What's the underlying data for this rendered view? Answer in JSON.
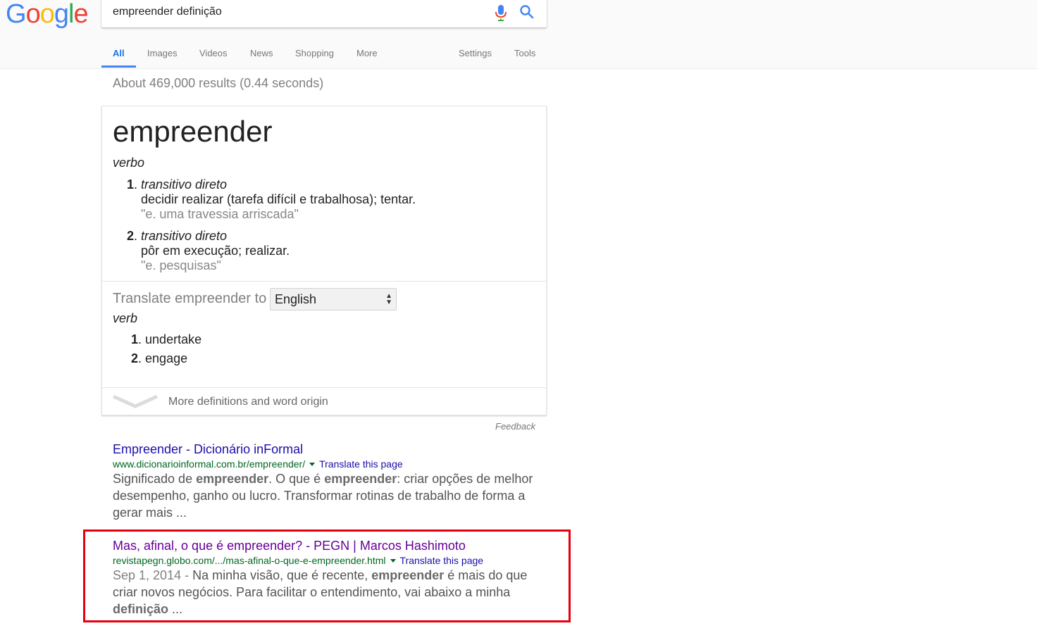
{
  "logo": {
    "letters": [
      "G",
      "o",
      "o",
      "g",
      "l",
      "e"
    ],
    "colors": [
      "#4285f4",
      "#ea4335",
      "#fbbc05",
      "#4285f4",
      "#34a853",
      "#ea4335"
    ]
  },
  "search": {
    "query": "empreender definição"
  },
  "tabs": [
    {
      "label": "All",
      "active": true
    },
    {
      "label": "Images"
    },
    {
      "label": "Videos"
    },
    {
      "label": "News"
    },
    {
      "label": "Shopping"
    },
    {
      "label": "More"
    },
    {
      "label": "Settings"
    },
    {
      "label": "Tools"
    }
  ],
  "stats": "About 469,000 results (0.44 seconds)",
  "dictionary": {
    "word": "empreender",
    "part_of_speech": "verbo",
    "definitions": [
      {
        "num": "1",
        "kind": "transitivo direto",
        "text": "decidir realizar (tarefa difícil e trabalhosa); tentar.",
        "example": "\"e. uma travessia arriscada\""
      },
      {
        "num": "2",
        "kind": "transitivo direto",
        "text": "pôr em execução; realizar.",
        "example": "\"e. pesquisas\""
      }
    ],
    "translate_label": "Translate empreender to",
    "language": "English",
    "trans_pos": "verb",
    "translations": [
      {
        "num": "1",
        "text": "undertake"
      },
      {
        "num": "2",
        "text": "engage"
      }
    ],
    "more_label": "More definitions and word origin"
  },
  "feedback": "Feedback",
  "results": [
    {
      "title": "Empreender - Dicionário inFormal",
      "url": "www.dicionarioinformal.com.br/empreender/",
      "translate": "Translate this page",
      "snippet_html": "Significado de <b>empreender</b>. O que é <b>empreender</b>: criar opções de melhor desempenho, ganho ou lucro. Transformar rotinas de trabalho de forma a gerar mais ..."
    },
    {
      "title": "Mas, afinal, o que é empreender? - PEGN | Marcos Hashimoto",
      "url": "revistapegn.globo.com/.../mas-afinal-o-que-e-empreender.html",
      "translate": "Translate this page",
      "date": "Sep 1, 2014 - ",
      "snippet_html": "Na minha visão, que é recente, <b>empreender</b> é mais do que criar novos negócios. Para facilitar o entendimento, vai abaixo a minha <b>definição</b> ..."
    }
  ]
}
